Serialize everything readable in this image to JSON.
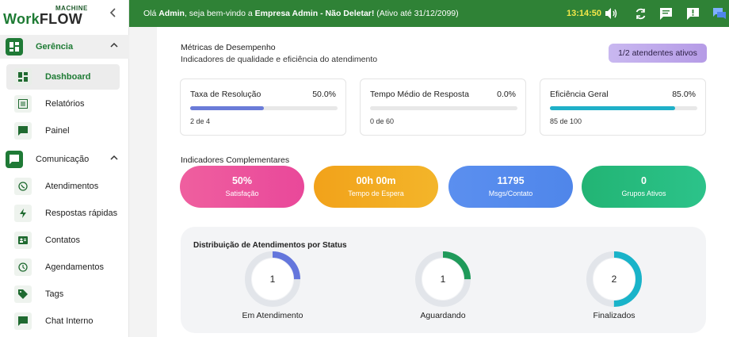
{
  "brand": {
    "machine": "MACHINE",
    "work": "Work",
    "flow": "FLOW"
  },
  "sidebar": {
    "sections": [
      {
        "label": "Gerência",
        "items": [
          {
            "label": "Dashboard",
            "icon": "dashboard-icon"
          },
          {
            "label": "Relatórios",
            "icon": "report-icon"
          },
          {
            "label": "Painel",
            "icon": "chat-icon"
          }
        ]
      },
      {
        "label": "Comunicação",
        "items": [
          {
            "label": "Atendimentos",
            "icon": "whatsapp-icon"
          },
          {
            "label": "Respostas rápidas",
            "icon": "lightning-icon"
          },
          {
            "label": "Contatos",
            "icon": "contact-card-icon"
          },
          {
            "label": "Agendamentos",
            "icon": "clock-icon"
          },
          {
            "label": "Tags",
            "icon": "tag-icon"
          },
          {
            "label": "Chat Interno",
            "icon": "chat-icon"
          }
        ]
      }
    ]
  },
  "topbar": {
    "welcome_prefix": "Olá ",
    "user": "Admin",
    "welcome_mid": ", seja bem-vindo a ",
    "company": "Empresa Admin - Não Deletar!",
    "welcome_suffix": " (Ativo até 31/12/2099)",
    "clock": "13:14:50"
  },
  "performance": {
    "title": "Métricas de Desempenho",
    "subtitle": "Indicadores de qualidade e eficiência do atendimento",
    "badge": "1/2 atendentes ativos",
    "metrics": [
      {
        "name": "Taxa de Resolução",
        "pct": "50.0%",
        "fraction": 0.5,
        "detail": "2 de 4",
        "color": "#6a7bd8"
      },
      {
        "name": "Tempo Médio de Resposta",
        "pct": "0.0%",
        "fraction": 0.0,
        "detail": "0 de 60",
        "color": "#f0a030"
      },
      {
        "name": "Eficiência Geral",
        "pct": "85.0%",
        "fraction": 0.85,
        "detail": "85 de 100",
        "color": "#1fb0c8"
      }
    ]
  },
  "complementary": {
    "title": "Indicadores Complementares",
    "cards": [
      {
        "value": "50%",
        "label": "Satisfação",
        "from": "#ef5f9f",
        "to": "#e9489a"
      },
      {
        "value": "00h 00m",
        "label": "Tempo de Espera",
        "from": "#f2a21a",
        "to": "#f3b52a"
      },
      {
        "value": "11795",
        "label": "Msgs/Contato",
        "from": "#5b8fef",
        "to": "#4f86ea"
      },
      {
        "value": "0",
        "label": "Grupos Ativos",
        "from": "#22b474",
        "to": "#2cc38a"
      }
    ]
  },
  "distribution": {
    "title": "Distribuição de Atendimentos por Status",
    "items": [
      {
        "label": "Em Atendimento",
        "value": "1",
        "fraction": 0.25,
        "color": "#6476dc"
      },
      {
        "label": "Aguardando",
        "value": "1",
        "fraction": 0.25,
        "color": "#1f9a5a"
      },
      {
        "label": "Finalizados",
        "value": "2",
        "fraction": 0.5,
        "color": "#19b3c9"
      }
    ]
  }
}
